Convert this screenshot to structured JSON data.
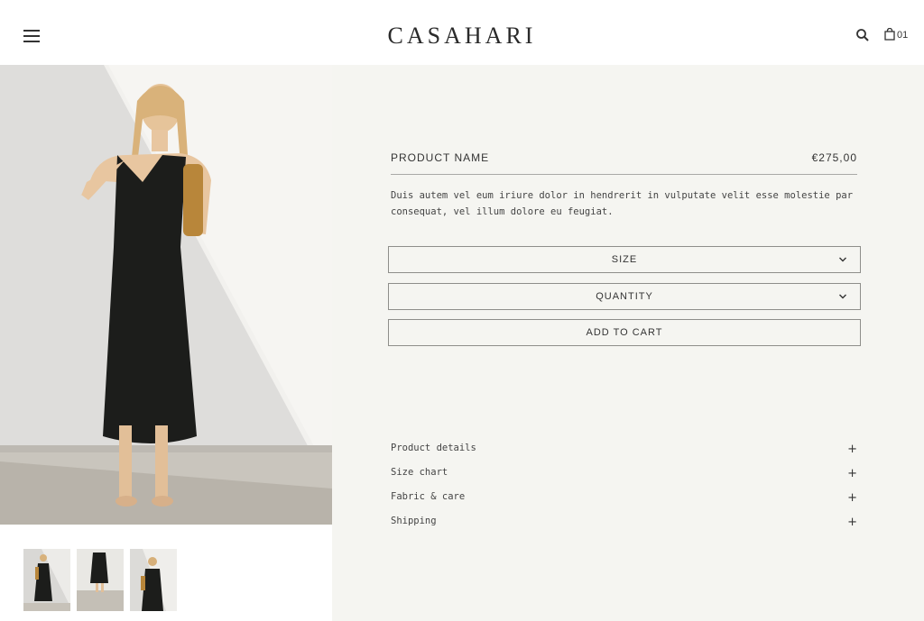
{
  "header": {
    "brand": "CASAHARI",
    "cart_count": "01"
  },
  "product": {
    "name": "PRODUCT NAME",
    "price": "€275,00",
    "description": "Duis autem vel eum iriure dolor in hendrerit in vulputate velit esse molestie par consequat, vel illum dolore eu feugiat."
  },
  "options": {
    "size_label": "SIZE",
    "quantity_label": "QUANTITY",
    "add_to_cart_label": "ADD TO CART"
  },
  "accordion": [
    {
      "label": "Product details"
    },
    {
      "label": "Size chart"
    },
    {
      "label": "Fabric & care"
    },
    {
      "label": "Shipping"
    }
  ],
  "gallery": {
    "thumbnail_count": 3
  },
  "colors": {
    "panel_bg": "#f5f5f1",
    "text": "#2a2a2a",
    "border": "#8e8e8a",
    "dress": "#1c1d1b"
  }
}
